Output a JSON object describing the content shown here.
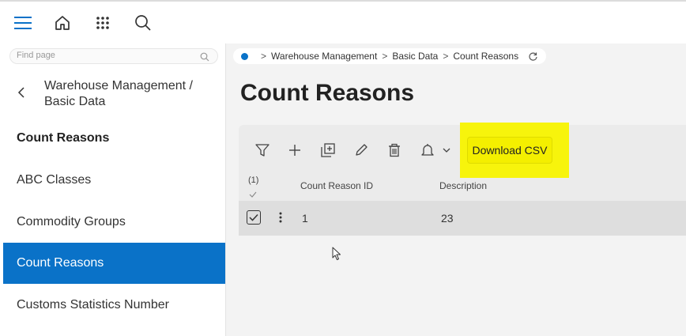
{
  "topbar": {
    "icons": [
      "hamburger-icon",
      "home-icon",
      "apps-grid-icon",
      "search-icon"
    ],
    "accent": "#0a72c8"
  },
  "sidebar": {
    "search_placeholder": "Find page",
    "path": "Warehouse Management / Basic Data",
    "items": [
      {
        "label": "Count Reasons",
        "style": "header"
      },
      {
        "label": "ABC Classes",
        "style": "normal"
      },
      {
        "label": "Commodity Groups",
        "style": "normal"
      },
      {
        "label": "Count Reasons",
        "style": "active"
      },
      {
        "label": "Customs Statistics Number",
        "style": "normal"
      }
    ]
  },
  "breadcrumb": {
    "items": [
      "Warehouse Management",
      "Basic Data",
      "Count Reasons"
    ]
  },
  "page": {
    "title": "Count Reasons"
  },
  "toolbar": {
    "icons": [
      "filter-icon",
      "add-icon",
      "duplicate-icon",
      "edit-icon",
      "delete-icon",
      "bell-icon",
      "chevron-down-icon"
    ],
    "download_csv_label": "Download CSV",
    "highlight_color": "#f7f40c"
  },
  "table": {
    "selection_count": "(1)",
    "columns": [
      "Count Reason ID",
      "Description"
    ],
    "rows": [
      {
        "selected": true,
        "count_reason_id": "1",
        "description": "23"
      }
    ]
  }
}
